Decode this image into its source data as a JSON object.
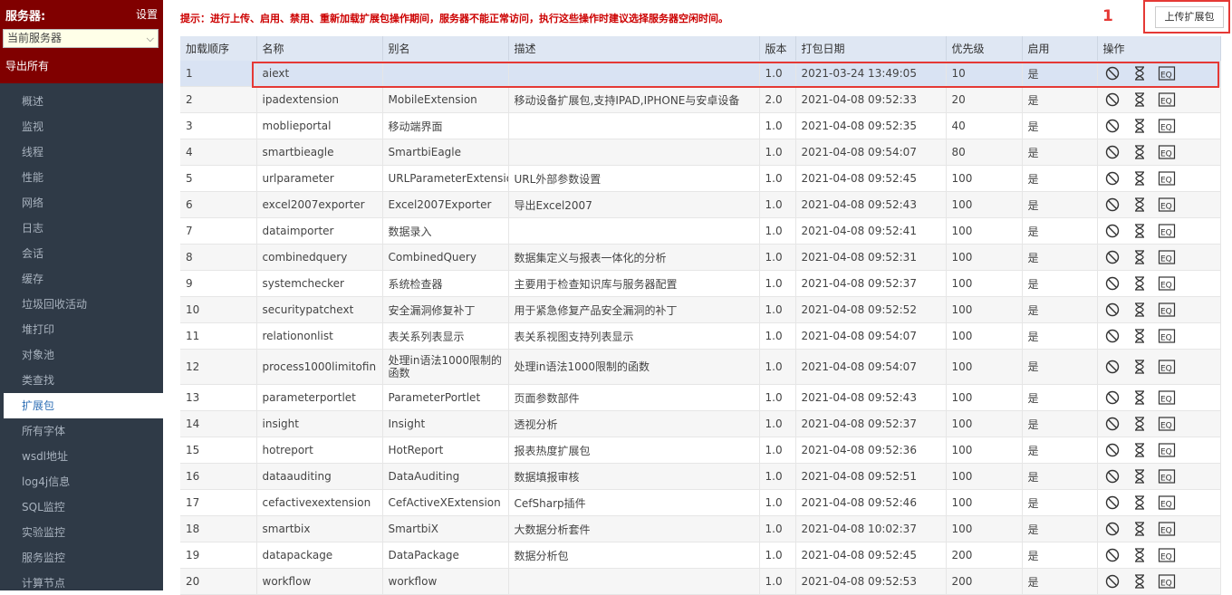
{
  "sidebar": {
    "title": "服务器:",
    "settings": "设置",
    "select_value": "当前服务器",
    "export_all": "导出所有",
    "items": [
      "概述",
      "监视",
      "线程",
      "性能",
      "网络",
      "日志",
      "会话",
      "缓存",
      "垃圾回收活动",
      "堆打印",
      "对象池",
      "类查找",
      "扩展包",
      "所有字体",
      "wsdl地址",
      "log4j信息",
      "SQL监控",
      "实验监控",
      "服务监控",
      "计算节点"
    ],
    "active_index": 12
  },
  "tip": "提示：进行上传、启用、禁用、重新加载扩展包操作期间，服务器不能正常访问，执行这些操作时建议选择服务器空闲时间。",
  "annotation_number": "1",
  "upload_button": "上传扩展包",
  "columns": [
    "加载顺序",
    "名称",
    "别名",
    "描述",
    "版本",
    "打包日期",
    "优先级",
    "启用",
    "操作"
  ],
  "rows": [
    {
      "order": "1",
      "name": "aiext",
      "alias": "",
      "desc": "",
      "version": "1.0",
      "date": "2021-03-24 13:49:05",
      "priority": "10",
      "enabled": "是"
    },
    {
      "order": "2",
      "name": "ipadextension",
      "alias": "MobileExtension",
      "desc": "移动设备扩展包,支持IPAD,IPHONE与安卓设备",
      "version": "2.0",
      "date": "2021-04-08 09:52:33",
      "priority": "20",
      "enabled": "是"
    },
    {
      "order": "3",
      "name": "moblieportal",
      "alias": "移动端界面",
      "desc": "",
      "version": "1.0",
      "date": "2021-04-08 09:52:35",
      "priority": "40",
      "enabled": "是"
    },
    {
      "order": "4",
      "name": "smartbieagle",
      "alias": "SmartbiEagle",
      "desc": "",
      "version": "1.0",
      "date": "2021-04-08 09:54:07",
      "priority": "80",
      "enabled": "是"
    },
    {
      "order": "5",
      "name": "urlparameter",
      "alias": "URLParameterExtension",
      "desc": "URL外部参数设置",
      "version": "1.0",
      "date": "2021-04-08 09:52:45",
      "priority": "100",
      "enabled": "是"
    },
    {
      "order": "6",
      "name": "excel2007exporter",
      "alias": "Excel2007Exporter",
      "desc": "导出Excel2007",
      "version": "1.0",
      "date": "2021-04-08 09:52:43",
      "priority": "100",
      "enabled": "是"
    },
    {
      "order": "7",
      "name": "dataimporter",
      "alias": "数据录入",
      "desc": "",
      "version": "1.0",
      "date": "2021-04-08 09:52:41",
      "priority": "100",
      "enabled": "是"
    },
    {
      "order": "8",
      "name": "combinedquery",
      "alias": "CombinedQuery",
      "desc": "数据集定义与报表一体化的分析",
      "version": "1.0",
      "date": "2021-04-08 09:52:31",
      "priority": "100",
      "enabled": "是"
    },
    {
      "order": "9",
      "name": "systemchecker",
      "alias": "系统检查器",
      "desc": "主要用于检查知识库与服务器配置",
      "version": "1.0",
      "date": "2021-04-08 09:52:37",
      "priority": "100",
      "enabled": "是"
    },
    {
      "order": "10",
      "name": "securitypatchext",
      "alias": "安全漏洞修复补丁",
      "desc": "用于紧急修复产品安全漏洞的补丁",
      "version": "1.0",
      "date": "2021-04-08 09:52:52",
      "priority": "100",
      "enabled": "是"
    },
    {
      "order": "11",
      "name": "relationonlist",
      "alias": "表关系列表显示",
      "desc": "表关系视图支持列表显示",
      "version": "1.0",
      "date": "2021-04-08 09:54:07",
      "priority": "100",
      "enabled": "是"
    },
    {
      "order": "12",
      "name": "process1000limitofin",
      "alias": "处理in语法1000限制的函数",
      "desc": "处理in语法1000限制的函数",
      "version": "1.0",
      "date": "2021-04-08 09:54:07",
      "priority": "100",
      "enabled": "是"
    },
    {
      "order": "13",
      "name": "parameterportlet",
      "alias": "ParameterPortlet",
      "desc": "页面参数部件",
      "version": "1.0",
      "date": "2021-04-08 09:52:43",
      "priority": "100",
      "enabled": "是"
    },
    {
      "order": "14",
      "name": "insight",
      "alias": "Insight",
      "desc": "透视分析",
      "version": "1.0",
      "date": "2021-04-08 09:52:37",
      "priority": "100",
      "enabled": "是"
    },
    {
      "order": "15",
      "name": "hotreport",
      "alias": "HotReport",
      "desc": "报表热度扩展包",
      "version": "1.0",
      "date": "2021-04-08 09:52:36",
      "priority": "100",
      "enabled": "是"
    },
    {
      "order": "16",
      "name": "dataauditing",
      "alias": "DataAuditing",
      "desc": "数据填报审核",
      "version": "1.0",
      "date": "2021-04-08 09:52:51",
      "priority": "100",
      "enabled": "是"
    },
    {
      "order": "17",
      "name": "cefactivexextension",
      "alias": "CefActiveXExtension",
      "desc": "CefSharp插件",
      "version": "1.0",
      "date": "2021-04-08 09:52:46",
      "priority": "100",
      "enabled": "是"
    },
    {
      "order": "18",
      "name": "smartbix",
      "alias": "SmartbiX",
      "desc": "大数据分析套件",
      "version": "1.0",
      "date": "2021-04-08 10:02:37",
      "priority": "100",
      "enabled": "是"
    },
    {
      "order": "19",
      "name": "datapackage",
      "alias": "DataPackage",
      "desc": "数据分析包",
      "version": "1.0",
      "date": "2021-04-08 09:52:45",
      "priority": "200",
      "enabled": "是"
    },
    {
      "order": "20",
      "name": "workflow",
      "alias": "workflow",
      "desc": "",
      "version": "1.0",
      "date": "2021-04-08 09:52:53",
      "priority": "200",
      "enabled": "是"
    }
  ],
  "row_actions": [
    "disable-icon",
    "reload-icon",
    "detail-icon"
  ],
  "colors": {
    "sidebar_bg": "#2f3a47",
    "header_bg": "#800000",
    "tip": "#cc0000",
    "annotation": "#e53935",
    "selected_row": "#d9e3f3"
  }
}
